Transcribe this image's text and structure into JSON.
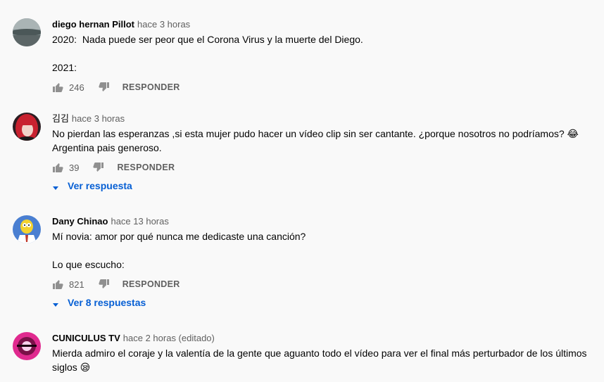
{
  "comments": [
    {
      "author": "diego hernan Pillot",
      "time": "hace 3 horas",
      "lines": [
        "2020:  Nada puede ser peor que el Corona Virus y la muerte del Diego.",
        "2021:"
      ],
      "likes": "246",
      "reply_label": "RESPONDER"
    },
    {
      "author": "김김",
      "time": "hace 3 horas",
      "lines": [
        "No pierdan las esperanzas ,si esta mujer pudo hacer un vídeo clip sin ser cantante. ¿porque nosotros no podríamos? 😂",
        "Argentina pais generoso."
      ],
      "likes": "39",
      "reply_label": "RESPONDER",
      "view_replies": "Ver respuesta"
    },
    {
      "author": "Dany Chinao",
      "time": "hace 13 horas",
      "lines": [
        "Mí novia: amor por qué nunca me dedicaste una canción?",
        "Lo que escucho:"
      ],
      "likes": "821",
      "reply_label": "RESPONDER",
      "view_replies": "Ver 8 respuestas"
    },
    {
      "author": "CUNICULUS TV",
      "time": "hace 2 horas (editado)",
      "lines": [
        "Mierda admiro el coraje y la valentía de la gente que aguanto todo el vídeo para ver el final más perturbador de los últimos",
        "siglos 😪"
      ]
    }
  ],
  "colors": {
    "link": "#065fd4",
    "secondary": "#606060",
    "background": "#f9f9f9"
  }
}
